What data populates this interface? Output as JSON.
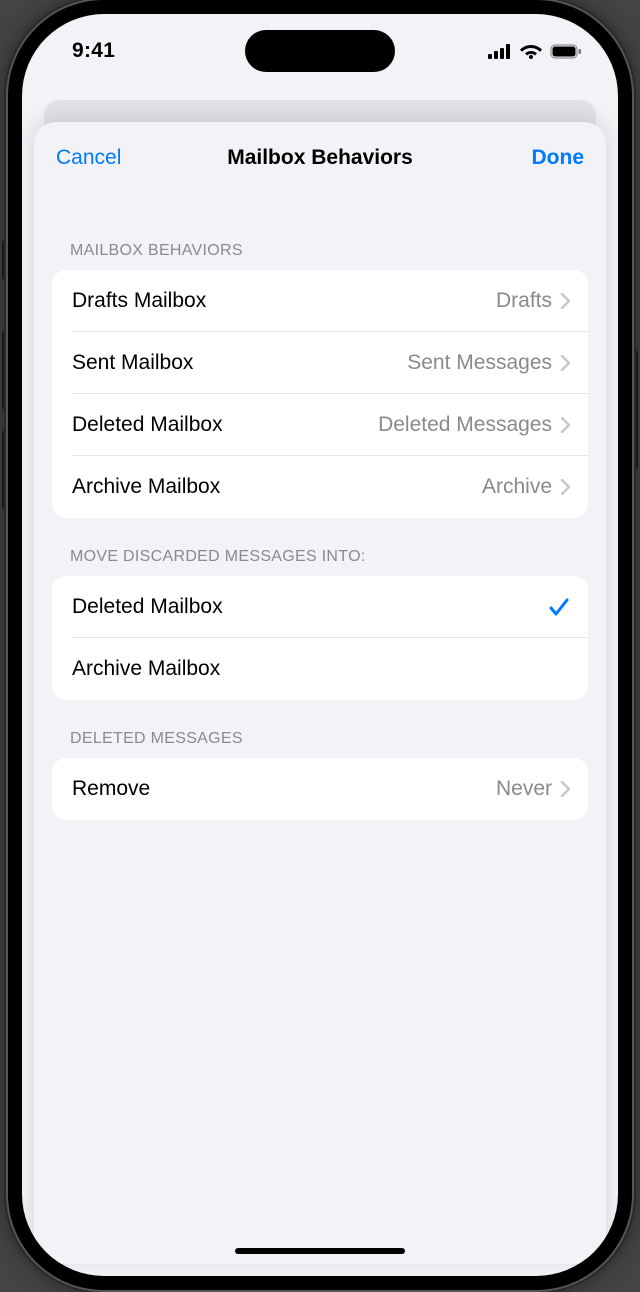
{
  "status": {
    "time": "9:41"
  },
  "nav": {
    "cancel": "Cancel",
    "title": "Mailbox Behaviors",
    "done": "Done"
  },
  "sections": {
    "behaviors": {
      "header": "MAILBOX BEHAVIORS",
      "rows": {
        "drafts": {
          "label": "Drafts Mailbox",
          "value": "Drafts"
        },
        "sent": {
          "label": "Sent Mailbox",
          "value": "Sent Messages"
        },
        "deleted": {
          "label": "Deleted Mailbox",
          "value": "Deleted Messages"
        },
        "archive": {
          "label": "Archive Mailbox",
          "value": "Archive"
        }
      }
    },
    "discarded": {
      "header": "MOVE DISCARDED MESSAGES INTO:",
      "rows": {
        "deleted": {
          "label": "Deleted Mailbox",
          "checked": true
        },
        "archive": {
          "label": "Archive Mailbox",
          "checked": false
        }
      }
    },
    "deletedMessages": {
      "header": "DELETED MESSAGES",
      "rows": {
        "remove": {
          "label": "Remove",
          "value": "Never"
        }
      }
    }
  }
}
